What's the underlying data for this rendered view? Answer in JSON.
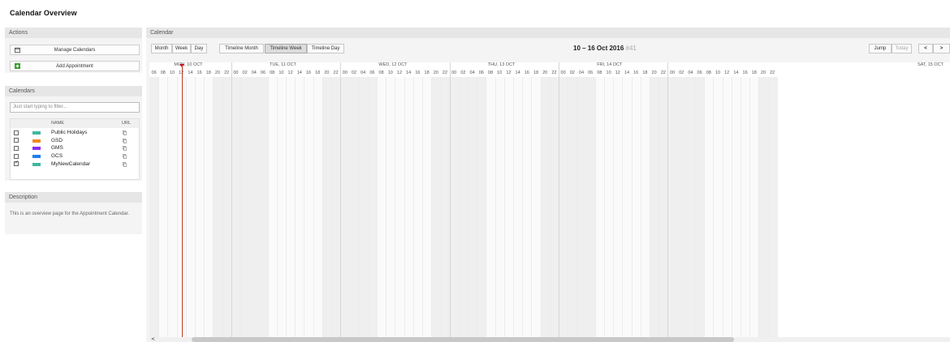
{
  "page": {
    "title": "Calendar Overview"
  },
  "actions": {
    "heading": "Actions",
    "buttons": [
      {
        "label": "Manage Calendars",
        "icon": "calendar-icon"
      },
      {
        "label": "Add Appointment",
        "icon": "plus-icon"
      }
    ]
  },
  "calendars": {
    "heading": "Calendars",
    "filter_placeholder": "Just start typing to filter...",
    "columns": {
      "name": "NAME",
      "url": "URL"
    },
    "items": [
      {
        "name": "Public Holidays",
        "color": "#3fb7a1",
        "checked": false
      },
      {
        "name": "GSD",
        "color": "#f08c1e",
        "checked": false
      },
      {
        "name": "GMS",
        "color": "#8b2cf0",
        "checked": false
      },
      {
        "name": "GCS",
        "color": "#1f7ff0",
        "checked": false
      },
      {
        "name": "MyNewCalendar",
        "color": "#3fb7a1",
        "checked": true
      }
    ]
  },
  "description": {
    "heading": "Description",
    "text": "This is an overview page for the Appointment Calendar."
  },
  "calendar": {
    "heading": "Calendar",
    "views": [
      "Month",
      "Week",
      "Day"
    ],
    "timeline_views": [
      "Timeline Month",
      "Timeline Week",
      "Timeline Day"
    ],
    "active_view": "Timeline Week",
    "range": "10 – 16 Oct 2016",
    "week": "#41",
    "jump_label": "Jump",
    "today_label": "Today",
    "prev": "<",
    "next": ">",
    "days": [
      "MON, 10 OCT",
      "TUE, 11 OCT",
      "WED, 12 OCT",
      "THU, 13 OCT",
      "FRI, 14 OCT",
      "SAT, 15 OCT"
    ],
    "hours": [
      "00",
      "02",
      "04",
      "06",
      "08",
      "10",
      "12",
      "14",
      "16",
      "18",
      "20",
      "22"
    ],
    "first_hours": [
      "06",
      "08",
      "10",
      "12",
      "14",
      "16",
      "18",
      "20",
      "22"
    ],
    "scroll_left": "<"
  }
}
